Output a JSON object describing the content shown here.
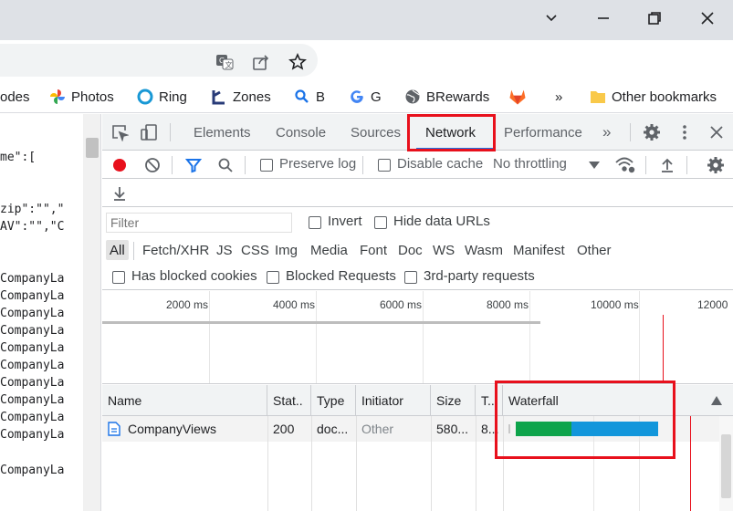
{
  "bookmarks": [
    {
      "label": "odes",
      "icon": "partial-bookmark"
    },
    {
      "label": "Photos",
      "icon": "google-photos-icon"
    },
    {
      "label": "Ring",
      "icon": "ring-icon"
    },
    {
      "label": "Zones",
      "icon": "zones-icon"
    },
    {
      "label": "B",
      "icon": "search-b-icon"
    },
    {
      "label": "G",
      "icon": "google-icon"
    },
    {
      "label": "BRewards",
      "icon": "globe-icon"
    },
    {
      "label": "",
      "icon": "gitlab-icon"
    },
    {
      "label": "»",
      "icon": "chevron-more"
    },
    {
      "label": "Other bookmarks",
      "icon": "folder-icon"
    }
  ],
  "page_lines": [
    "me\":[",
    "",
    "",
    "zip\":\"\",\"",
    "AV\":\"\",\"C",
    "",
    "",
    "CompanyLa",
    "CompanyLa",
    "CompanyLa",
    "CompanyLa",
    "CompanyLa",
    "CompanyLa",
    "CompanyLa",
    "CompanyLa",
    "CompanyLa",
    "CompanyLa",
    "CompanyLa"
  ],
  "devtools": {
    "tabs": [
      "Elements",
      "Console",
      "Sources",
      "Network",
      "Performance"
    ],
    "more_tabs": "»",
    "active_tab": "Network",
    "toolbar": {
      "preserve_log": "Preserve log",
      "disable_cache": "Disable cache",
      "throttling": "No throttling"
    },
    "filter": {
      "placeholder": "Filter",
      "invert": "Invert",
      "hide_data_urls": "Hide data URLs"
    },
    "types": [
      "All",
      "Fetch/XHR",
      "JS",
      "CSS",
      "Img",
      "Media",
      "Font",
      "Doc",
      "WS",
      "Wasm",
      "Manifest",
      "Other"
    ],
    "blocked": {
      "has_blocked_cookies": "Has blocked cookies",
      "blocked_requests": "Blocked Requests",
      "third_party": "3rd-party requests"
    },
    "overview_ticks": [
      "2000 ms",
      "4000 ms",
      "6000 ms",
      "8000 ms",
      "10000 ms",
      "12000"
    ],
    "columns": {
      "name": "Name",
      "status": "Stat..",
      "type": "Type",
      "initiator": "Initiator",
      "size": "Size",
      "time": "T..",
      "waterfall": "Waterfall"
    },
    "rows": [
      {
        "name": "CompanyViews",
        "status": "200",
        "type": "doc...",
        "initiator": "Other",
        "size": "580...",
        "time": "8...",
        "waterfall_waiting_fraction": 0.39,
        "waterfall_download_fraction": 0.61
      }
    ]
  },
  "colors": {
    "accent": "#1a73e8",
    "highlight_box": "#e8101c",
    "record": "#e8101c",
    "waterfall_waiting": "#0ea44b",
    "waterfall_download": "#1296db"
  }
}
